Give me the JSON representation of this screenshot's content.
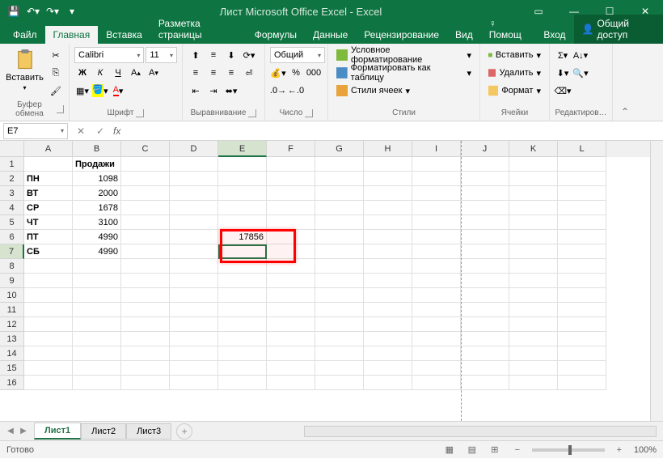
{
  "title": "Лист Microsoft Office Excel - Excel",
  "qat": {
    "save": "💾",
    "undo": "↶",
    "redo": "↷"
  },
  "tabs": [
    "Файл",
    "Главная",
    "Вставка",
    "Разметка страницы",
    "Формулы",
    "Данные",
    "Рецензирование",
    "Вид",
    "♀ Помощ",
    "Вход"
  ],
  "active_tab": 1,
  "share": "Общий доступ",
  "ribbon": {
    "clipboard": {
      "paste": "Вставить",
      "label": "Буфер обмена"
    },
    "font": {
      "name": "Calibri",
      "size": "11",
      "bold": "Ж",
      "italic": "К",
      "underline": "Ч",
      "label": "Шрифт"
    },
    "align": {
      "label": "Выравнивание"
    },
    "number": {
      "format": "Общий",
      "label": "Число"
    },
    "styles": {
      "cond": "Условное форматирование",
      "table": "Форматировать как таблицу",
      "cell": "Стили ячеек",
      "label": "Стили"
    },
    "cells": {
      "insert": "Вставить",
      "delete": "Удалить",
      "format": "Формат",
      "label": "Ячейки"
    },
    "editing": {
      "label": "Редактиров…"
    }
  },
  "name_box": "E7",
  "fx": "fx",
  "columns": [
    "A",
    "B",
    "C",
    "D",
    "E",
    "F",
    "G",
    "H",
    "I",
    "J",
    "K",
    "L"
  ],
  "rows": [
    {
      "n": "1",
      "A": "",
      "B": "Продажи",
      "bold": [
        "B"
      ]
    },
    {
      "n": "2",
      "A": "ПН",
      "B": "1098",
      "bold": [
        "A"
      ],
      "right": [
        "B"
      ]
    },
    {
      "n": "3",
      "A": "ВТ",
      "B": "2000",
      "bold": [
        "A"
      ],
      "right": [
        "B"
      ]
    },
    {
      "n": "4",
      "A": "СР",
      "B": "1678",
      "bold": [
        "A"
      ],
      "right": [
        "B"
      ]
    },
    {
      "n": "5",
      "A": "ЧТ",
      "B": "3100",
      "bold": [
        "A"
      ],
      "right": [
        "B"
      ]
    },
    {
      "n": "6",
      "A": "ПТ",
      "B": "4990",
      "E": "17856",
      "bold": [
        "A"
      ],
      "right": [
        "B",
        "E"
      ]
    },
    {
      "n": "7",
      "A": "СБ",
      "B": "4990",
      "bold": [
        "A"
      ],
      "right": [
        "B"
      ]
    },
    {
      "n": "8"
    },
    {
      "n": "9"
    },
    {
      "n": "10"
    },
    {
      "n": "11"
    },
    {
      "n": "12"
    },
    {
      "n": "13"
    },
    {
      "n": "14"
    },
    {
      "n": "15"
    },
    {
      "n": "16"
    }
  ],
  "active_cell": {
    "row": 7,
    "col": "E"
  },
  "highlighted_cells": [
    "E6",
    "E7"
  ],
  "sheets": [
    "Лист1",
    "Лист2",
    "Лист3"
  ],
  "active_sheet": 0,
  "status": "Готово",
  "zoom": "100%",
  "chart_data": {
    "type": "table",
    "title": "Продажи",
    "categories": [
      "ПН",
      "ВТ",
      "СР",
      "ЧТ",
      "ПТ",
      "СБ"
    ],
    "values": [
      1098,
      2000,
      1678,
      3100,
      4990,
      4990
    ],
    "sum_displayed": 17856
  }
}
